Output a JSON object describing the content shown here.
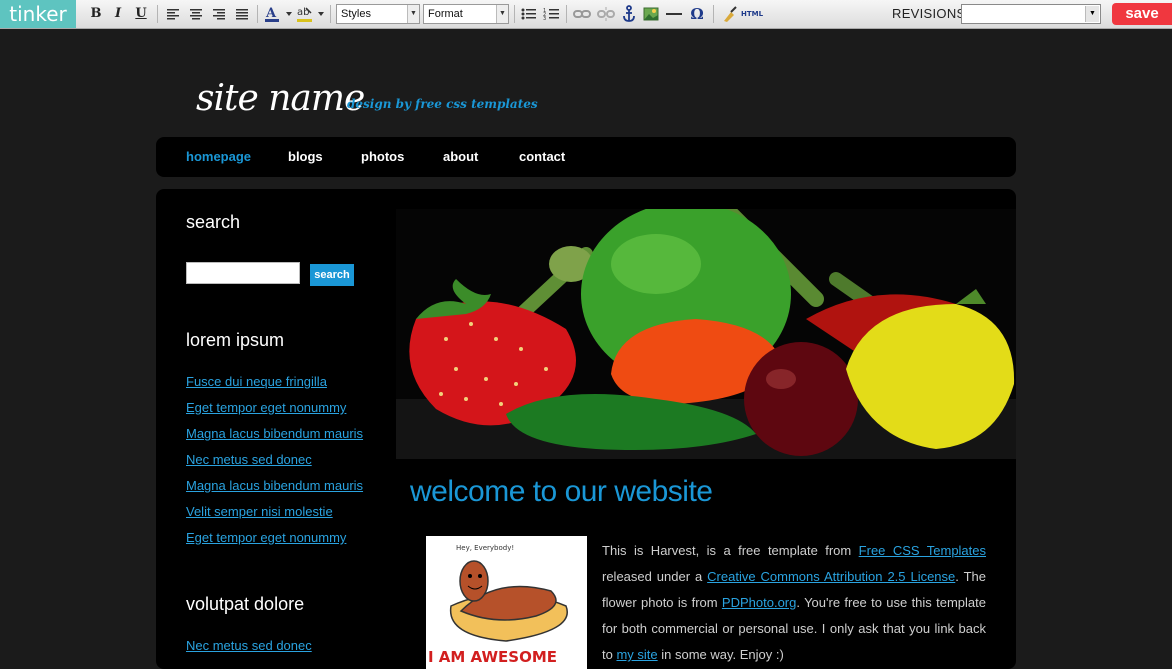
{
  "toolbar": {
    "brand": "tinker",
    "bold": "B",
    "italic": "I",
    "underline": "U",
    "styles_select": "Styles",
    "format_select": "Format",
    "omega": "Ω",
    "html_label": "HTML",
    "revisions_label": "REVISIONS",
    "revisions_value": "",
    "save_label": "save"
  },
  "site": {
    "title": "site name",
    "subtitle": "design by free css templates"
  },
  "nav": {
    "items": [
      "homepage",
      "blogs",
      "photos",
      "about",
      "contact"
    ],
    "active": "homepage"
  },
  "sidebar": {
    "search_heading": "search",
    "search_value": "",
    "search_button": "search",
    "section1_heading": "lorem ipsum",
    "section1_links": [
      "Fusce dui neque fringilla",
      "Eget tempor eget nonummy",
      "Magna lacus bibendum mauris",
      "Nec metus sed donec",
      "Magna lacus bibendum mauris",
      "Velit semper nisi molestie",
      "Eget tempor eget nonummy"
    ],
    "section2_heading": "volutpat dolore",
    "section2_links": [
      "Nec metus sed donec"
    ]
  },
  "main": {
    "heading": "welcome to our website",
    "thumb_caption_top": "Hey, Everybody!",
    "thumb_caption_bottom": "I AM AWESOME",
    "p_1": "This is Harvest, is a free template from ",
    "link_1": "Free CSS Templates",
    "p_2": " released under a ",
    "link_2": "Creative Commons Attribution 2.5 License",
    "p_3": ". The flower photo is from ",
    "link_3": "PDPhoto.org",
    "p_4": ". You're free to use this template for both commercial or personal use. I only ask that you link back to ",
    "link_4": "my site",
    "p_5": " in some way. Enjoy :)"
  },
  "colors": {
    "accent": "#1a97d6",
    "background": "#1b1b1b",
    "panel": "#000000",
    "brand": "#5ec4c0",
    "save": "#f0373f"
  }
}
